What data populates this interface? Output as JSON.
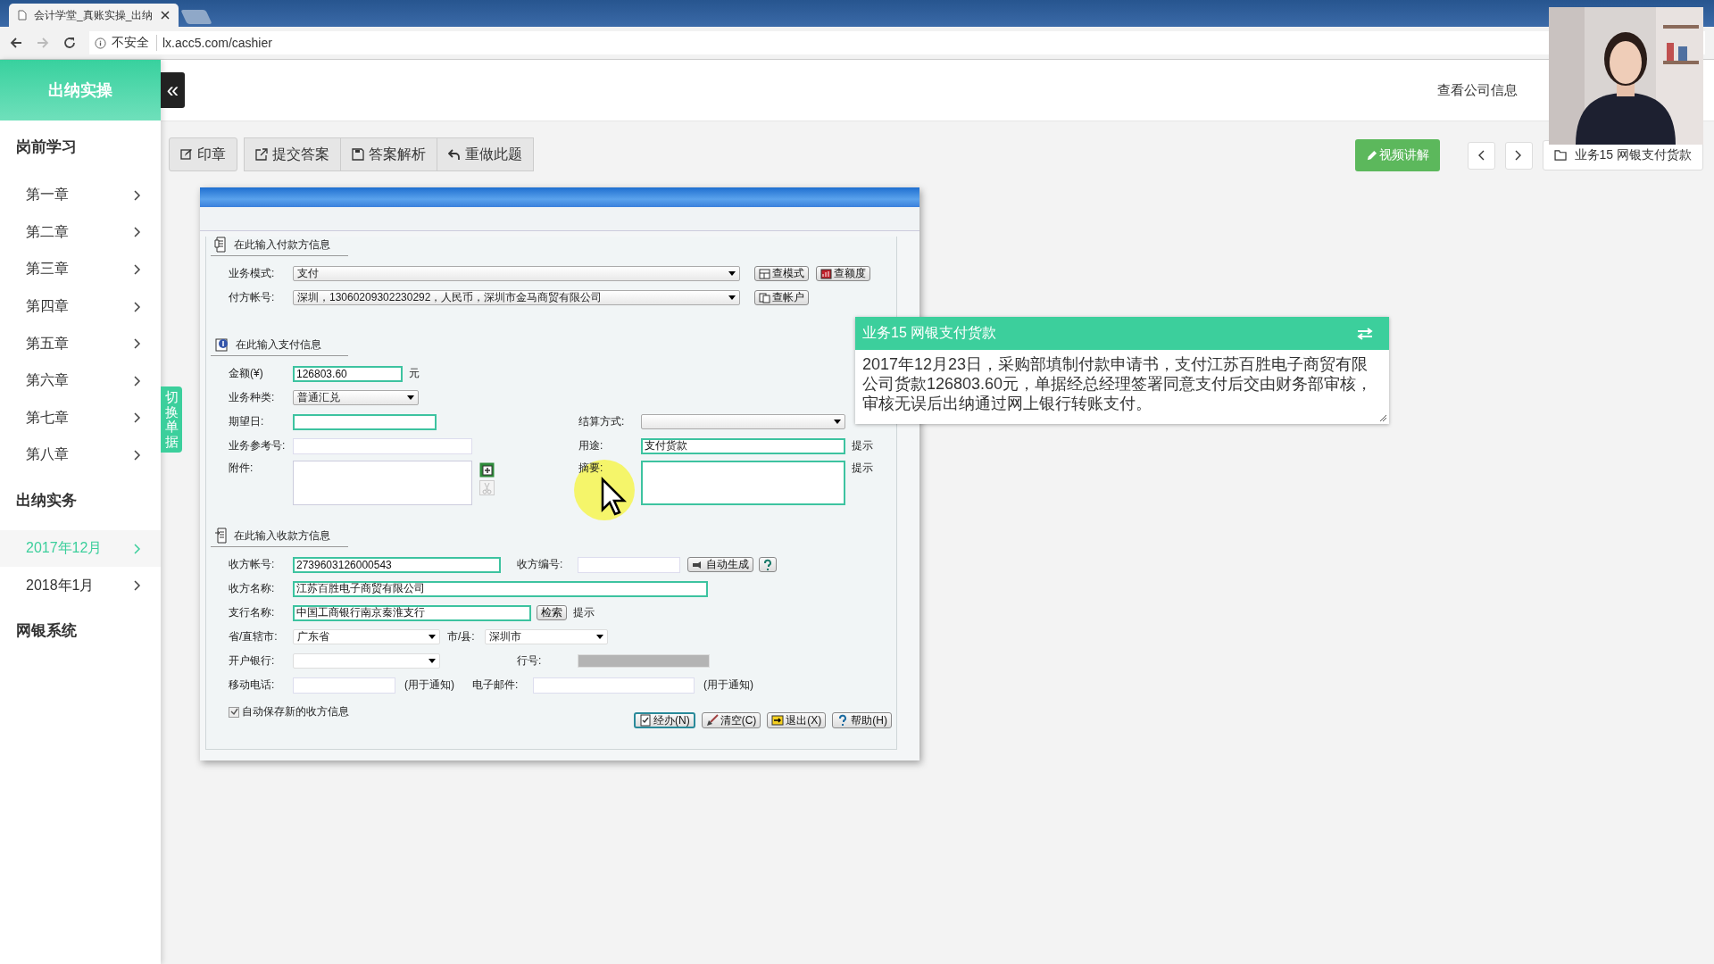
{
  "browser": {
    "tab_title": "会计学堂_真账实操_出纳",
    "security": "不安全",
    "url": "lx.acc5.com/cashier"
  },
  "header": {
    "logo": "出纳实操",
    "collapse": "«",
    "company_link": "查看公司信息"
  },
  "sidebar": {
    "sections": [
      {
        "title": "岗前学习",
        "items": [
          {
            "label": "第一章",
            "selected": false
          },
          {
            "label": "第二章",
            "selected": false
          },
          {
            "label": "第三章",
            "selected": false
          },
          {
            "label": "第四章",
            "selected": false
          },
          {
            "label": "第五章",
            "selected": false
          },
          {
            "label": "第六章",
            "selected": false
          },
          {
            "label": "第七章",
            "selected": false
          },
          {
            "label": "第八章",
            "selected": false
          }
        ]
      },
      {
        "title": "出纳实务",
        "items": [
          {
            "label": "2017年12月",
            "selected": true
          },
          {
            "label": "2018年1月",
            "selected": false
          }
        ]
      },
      {
        "title": "网银系统"
      }
    ]
  },
  "switch_tab": "切换单据",
  "toolbar": {
    "buttons": [
      {
        "label": "印章",
        "kind": "stamp"
      },
      {
        "label": "提交答案",
        "kind": "submit"
      },
      {
        "label": "答案解析",
        "kind": "save"
      },
      {
        "label": "重做此题",
        "kind": "undo"
      }
    ],
    "video_button": "视频讲解",
    "task_button": "业务15 网银支付货款"
  },
  "form": {
    "payer": {
      "heading": "在此输入付款方信息",
      "mode": {
        "label": "业务模式:",
        "value": "支付"
      },
      "account": {
        "label": "付方帐号:",
        "value": "深圳，13060209302230292，人民币，深圳市金马商贸有限公司"
      },
      "buttons": [
        "查模式",
        "查额度",
        "查帐户"
      ]
    },
    "payment": {
      "heading": "在此输入支付信息",
      "amount": {
        "label": "金额(¥)",
        "value": "126803.60",
        "unit": "元",
        "highlighted": true
      },
      "type": {
        "label": "业务种类:",
        "value": "普通汇兑"
      },
      "date": {
        "label": "期望日:",
        "highlighted": true
      },
      "ref": {
        "label": "业务参考号:",
        "highlighted": false
      },
      "attachment": {
        "label": "附件:"
      },
      "settlement": {
        "label": "结算方式:"
      },
      "purpose": {
        "label": "用途:",
        "value": "支付货款",
        "highlighted": true,
        "hint": "提示"
      },
      "summary": {
        "label": "摘要:",
        "highlighted": true,
        "hint": "提示"
      }
    },
    "payee": {
      "heading": "在此输入收款方信息",
      "account": {
        "label": "收方帐号:",
        "value": "2739603126000543",
        "highlighted": true
      },
      "code": {
        "label": "收方编号:",
        "highlighted": false,
        "button": "自动生成"
      },
      "name": {
        "label": "收方名称:",
        "value": "江苏百胜电子商贸有限公司",
        "highlighted": true
      },
      "branch": {
        "label": "支行名称:",
        "value": "中国工商银行南京秦淮支行",
        "highlighted": true,
        "button": "检索",
        "hint": "提示"
      },
      "province": {
        "label": "省/直辖市:",
        "value": "广东省"
      },
      "city": {
        "label": "市/县:",
        "value": "深圳市"
      },
      "bank": {
        "label": "开户银行:"
      },
      "bank_no": {
        "label": "行号:"
      },
      "phone": {
        "label": "移动电话:",
        "highlighted": false,
        "note": "(用于通知)"
      },
      "email": {
        "label": "电子邮件:",
        "highlighted": false,
        "note": "(用于通知)"
      }
    },
    "auto_save": {
      "label": "自动保存新的收方信息",
      "checked": true
    },
    "actions": [
      {
        "label": "经办(N)",
        "kind": "process",
        "focused": true
      },
      {
        "label": "清空(C)",
        "kind": "clear",
        "focused": false
      },
      {
        "label": "退出(X)",
        "kind": "exit",
        "focused": false
      },
      {
        "label": "帮助(H)",
        "kind": "help",
        "focused": false
      }
    ]
  },
  "task": {
    "title": "业务15 网银支付货款",
    "text": "2017年12月23日，采购部填制付款申请书，支付江苏百胜电子商贸有限公司货款126803.60元，单据经总经理签署同意支付后交由财务部审核，审核无误后出纳通过网上银行转账支付。"
  }
}
